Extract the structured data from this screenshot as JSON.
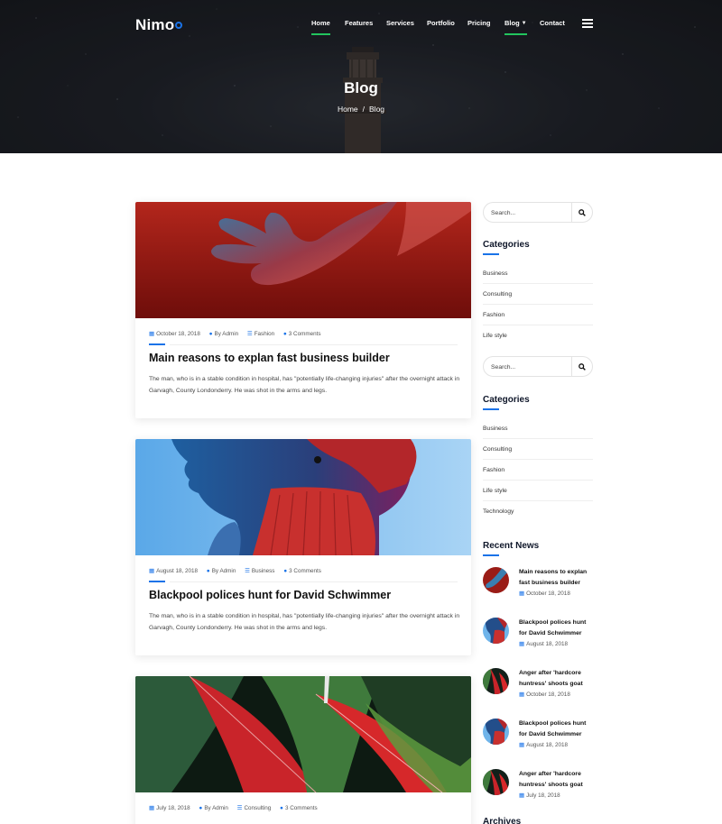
{
  "header": {
    "logo": "Nimo",
    "nav": [
      {
        "label": "Home",
        "active": true
      },
      {
        "label": "Features"
      },
      {
        "label": "Services"
      },
      {
        "label": "Portfolio"
      },
      {
        "label": "Pricing"
      },
      {
        "label": "Blog",
        "active": true,
        "has_dropdown": true
      },
      {
        "label": "Contact"
      }
    ],
    "menu_icon": "hamburger-icon"
  },
  "hero": {
    "title": "Blog",
    "breadcrumb": {
      "home": "Home",
      "separator": "/",
      "current": "Blog"
    }
  },
  "posts": [
    {
      "image": "red hand against red background",
      "date": "October 18, 2018",
      "author": "By Admin",
      "category": "Fashion",
      "comments": "3 Comments",
      "title": "Main reasons to explan fast business builder",
      "excerpt": "The man, who is in a stable condition in hospital, has \"potentially life-changing injuries\" after the overnight attack in Garvagh, County Londonderry. He was shot in the arms and legs."
    },
    {
      "image": "person in red turtleneck against blue sky",
      "date": "August 18, 2018",
      "author": "By Admin",
      "category": "Business",
      "comments": "3 Comments",
      "title": "Blackpool polices hunt for David Schwimmer",
      "excerpt": "The man, who is in a stable condition in hospital, has \"potentially life-changing injuries\" after the overnight attack in Garvagh, County Londonderry. He was shot in the arms and legs."
    },
    {
      "image": "red and green leaves",
      "date": "July 18, 2018",
      "author": "By Admin",
      "category": "Consulting",
      "comments": "3 Comments"
    }
  ],
  "sidebar": {
    "search_placeholder": "Search...",
    "categories_title": "Categories",
    "categories_1": [
      "Business",
      "Consulting",
      "Fashion",
      "Life style"
    ],
    "categories_2": [
      "Business",
      "Consulting",
      "Fashion",
      "Life style",
      "Technology"
    ],
    "recent_news_title": "Recent News",
    "recent_news": [
      {
        "title": "Main reasons to explan fast business builder",
        "date": "October 18, 2018"
      },
      {
        "title": "Blackpool polices hunt for David Schwimmer",
        "date": "August 18, 2018"
      },
      {
        "title": "Anger after 'hardcore huntress' shoots goat",
        "date": "October 18, 2018"
      },
      {
        "title": "Blackpool polices hunt for David Schwimmer",
        "date": "August 18, 2018"
      },
      {
        "title": "Anger after 'hardcore huntress' shoots goat",
        "date": "July 18, 2018"
      }
    ],
    "archives_title": "Archives"
  },
  "colors": {
    "accent": "#1a73e8",
    "nav_active": "#22c55e",
    "title": "#111111"
  }
}
